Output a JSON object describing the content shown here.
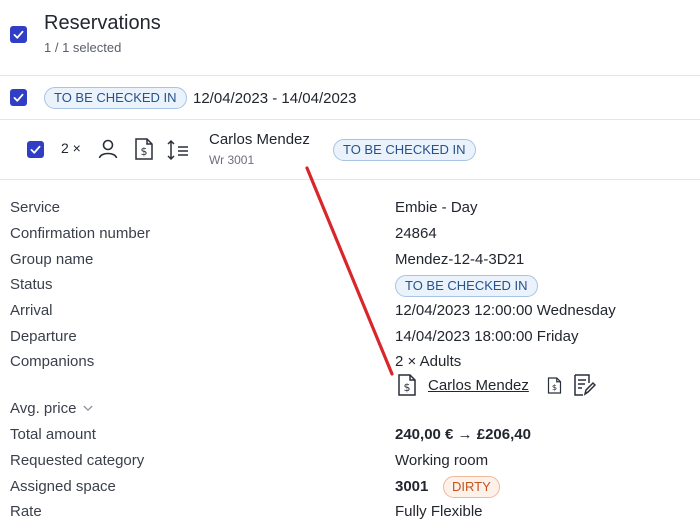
{
  "header": {
    "title": "Reservations",
    "selected": "1 / 1 selected"
  },
  "group": {
    "status_badge": "TO BE CHECKED IN",
    "date_range": "12/04/2023 - 14/04/2023"
  },
  "reservation_row": {
    "count": "2 ×",
    "guest_name": "Carlos Mendez",
    "space": "Wr 3001",
    "status_badge": "TO BE CHECKED IN"
  },
  "details": {
    "service": {
      "label": "Service",
      "value": "Embie - Day"
    },
    "confirmation": {
      "label": "Confirmation number",
      "value": "24864"
    },
    "group_name": {
      "label": "Group name",
      "value": "Mendez-12-4-3D21"
    },
    "status": {
      "label": "Status",
      "value": "TO BE CHECKED IN"
    },
    "arrival": {
      "label": "Arrival",
      "value": "12/04/2023 12:00:00 Wednesday"
    },
    "departure": {
      "label": "Departure",
      "value": "14/04/2023 18:00:00 Friday"
    },
    "companions": {
      "label": "Companions",
      "value": "2 × Adults",
      "companion_name": "Carlos Mendez"
    },
    "avg_price": {
      "label": "Avg. price"
    },
    "total_amount": {
      "label": "Total amount",
      "value": "240,00 € → £206,40"
    },
    "requested_category": {
      "label": "Requested category",
      "value": "Working room"
    },
    "assigned_space": {
      "label": "Assigned space",
      "value": "3001",
      "state_badge": "DIRTY"
    },
    "rate": {
      "label": "Rate",
      "value": "Fully Flexible"
    }
  },
  "colors": {
    "accent": "#2f3ec4",
    "status_blue": "#27528a",
    "dirty_orange": "#c4541d",
    "annotation_red": "#d9262b"
  }
}
